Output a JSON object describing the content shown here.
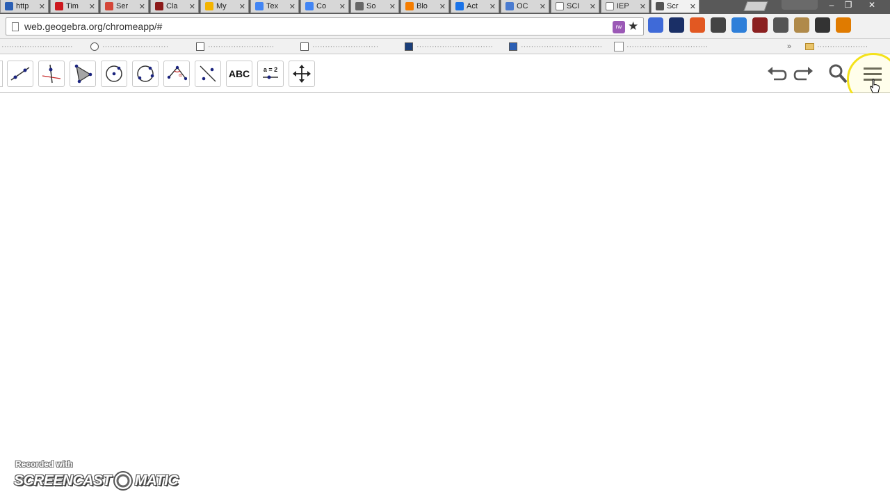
{
  "browser": {
    "tabs": [
      {
        "label": "http",
        "color": "#2b5fb4",
        "active": false
      },
      {
        "label": "Tim",
        "color": "#cc181e",
        "active": false
      },
      {
        "label": "Ser",
        "color": "#d44638",
        "active": false
      },
      {
        "label": "Cla",
        "color": "#8b1a1a",
        "active": false
      },
      {
        "label": "My",
        "color": "#f4b400",
        "active": false
      },
      {
        "label": "Tex",
        "color": "#4285f4",
        "active": false
      },
      {
        "label": "Co",
        "color": "#4285f4",
        "active": false
      },
      {
        "label": "So",
        "color": "#666666",
        "active": false
      },
      {
        "label": "Blo",
        "color": "#f57d00",
        "active": false
      },
      {
        "label": "Act",
        "color": "#1a73e8",
        "active": false
      },
      {
        "label": "OC",
        "color": "#4a7bd0",
        "active": false
      },
      {
        "label": "SCI",
        "color": "#ffffff",
        "active": false
      },
      {
        "label": "IEP",
        "color": "#ffffff",
        "active": false
      },
      {
        "label": "Scr",
        "color": "#555555",
        "active": true
      }
    ],
    "window_buttons": [
      "–",
      "❐",
      "✕"
    ],
    "url": "web.geogebra.org/chromeapp/#",
    "extension_colors": [
      "#3f6ad8",
      "#1a2f66",
      "#e25822",
      "#444444",
      "#2e7fd9",
      "#8b2020",
      "#555555",
      "#b08a4a",
      "#333333",
      "#e07b00"
    ]
  },
  "geogebra": {
    "tools": [
      {
        "name": "line-tool",
        "label": ""
      },
      {
        "name": "perpendicular-line-tool",
        "label": ""
      },
      {
        "name": "polygon-tool",
        "label": ""
      },
      {
        "name": "circle-center-point-tool",
        "label": ""
      },
      {
        "name": "circle-three-points-tool",
        "label": ""
      },
      {
        "name": "angle-tool",
        "label": ""
      },
      {
        "name": "reflect-line-tool",
        "label": ""
      },
      {
        "name": "text-tool",
        "label": "ABC"
      },
      {
        "name": "slider-tool",
        "label": "a = 2"
      },
      {
        "name": "move-graphics-view-tool",
        "label": ""
      }
    ],
    "right_buttons": [
      "undo",
      "redo",
      "search",
      "main-menu"
    ]
  },
  "watermark": {
    "small_text": "Recorded with",
    "logo_left": "SCREENCAST",
    "logo_right": "MATIC"
  }
}
